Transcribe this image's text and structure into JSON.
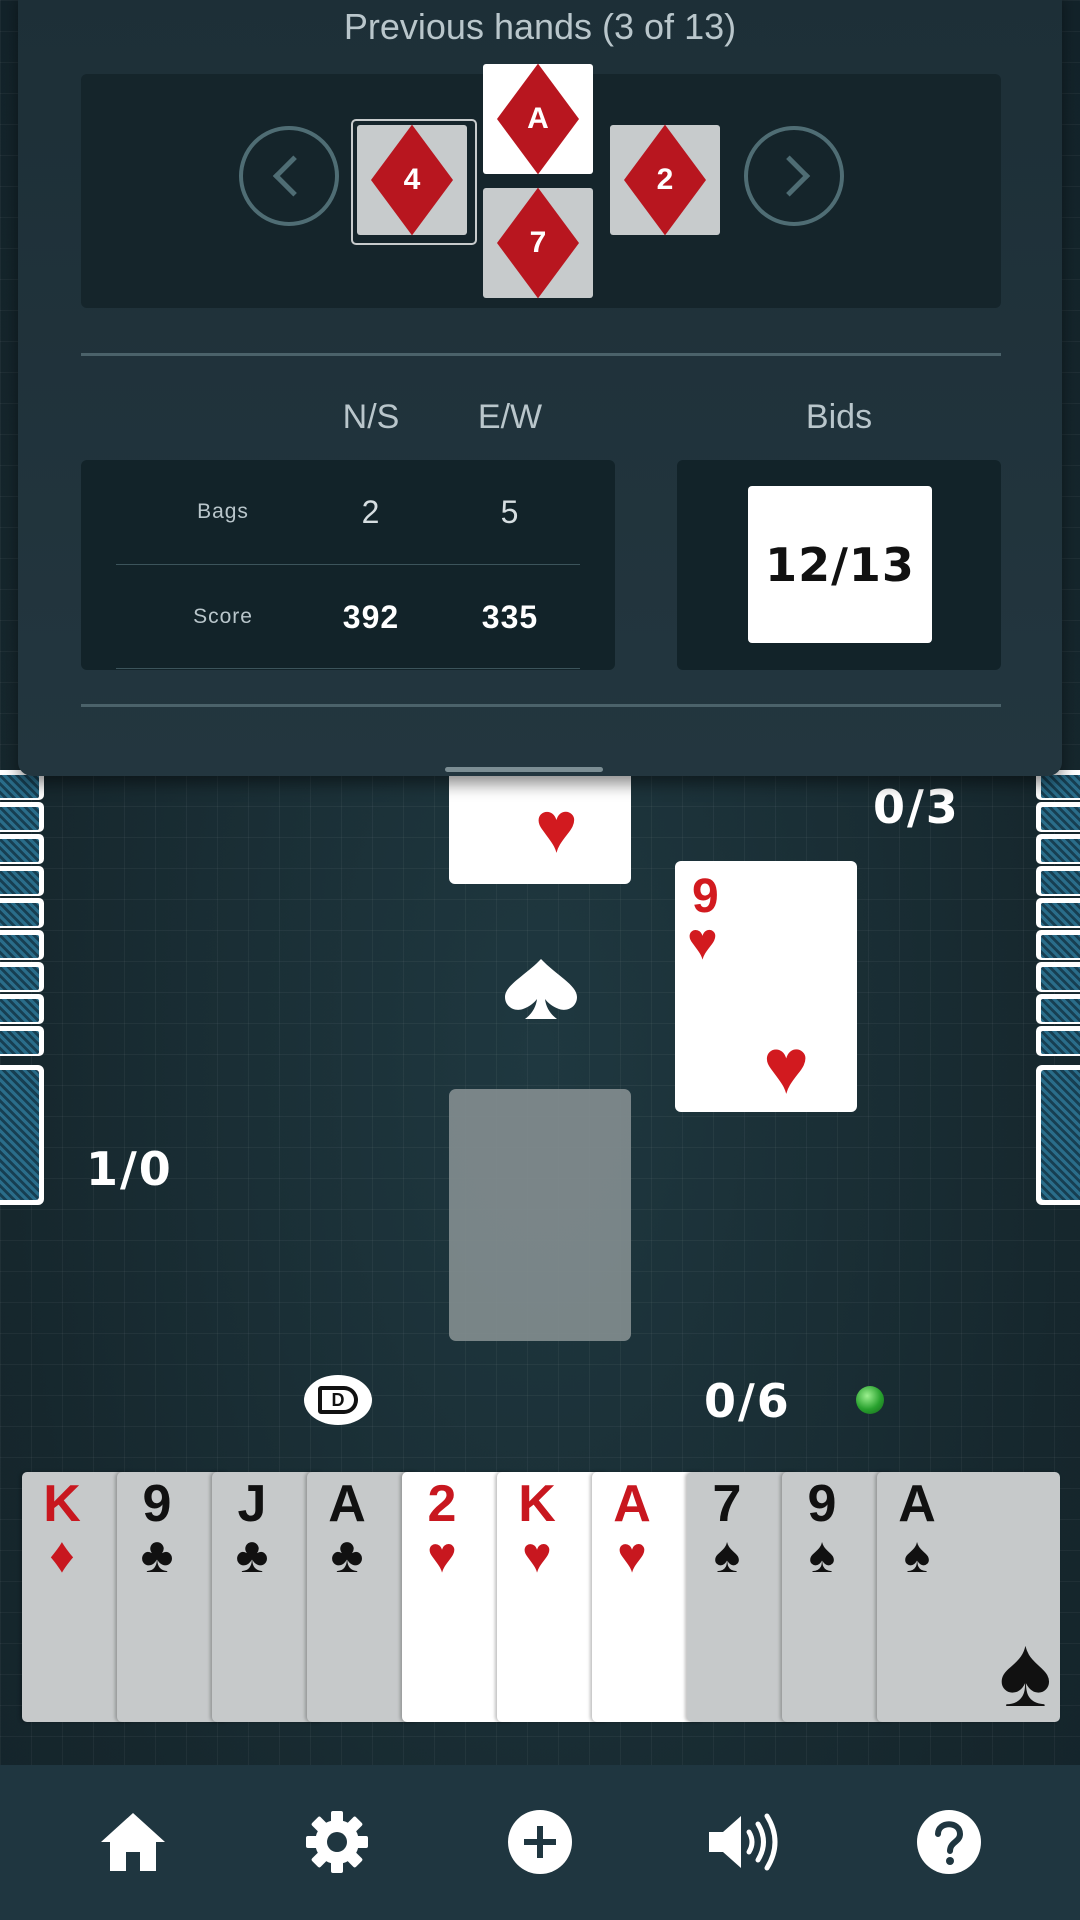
{
  "panel": {
    "title": "Previous hands (3 of 13)",
    "trick": {
      "north": {
        "rank": "A",
        "suit": "diamond"
      },
      "west": {
        "rank": "4",
        "suit": "diamond"
      },
      "east": {
        "rank": "2",
        "suit": "diamond"
      },
      "south": {
        "rank": "7",
        "suit": "diamond"
      }
    },
    "columns": {
      "ns": "N/S",
      "ew": "E/W",
      "bids": "Bids"
    },
    "rows": {
      "bags": {
        "label": "Bags",
        "ns": "2",
        "ew": "5"
      },
      "score": {
        "label": "Score",
        "ns": "392",
        "ew": "335"
      }
    },
    "bids_value": "12/13"
  },
  "table": {
    "north_count": "0/3",
    "west_count": "1/0",
    "south_count": "0/6",
    "trump_suit": "spade-icon",
    "dealer_label": "D",
    "played_east": {
      "rank": "9",
      "suit": "♥"
    },
    "played_north_suit": "♥"
  },
  "hand": [
    {
      "rank": "K",
      "suit": "♦",
      "color": "red",
      "active": false
    },
    {
      "rank": "9",
      "suit": "♣",
      "color": "black",
      "active": false
    },
    {
      "rank": "J",
      "suit": "♣",
      "color": "black",
      "active": false
    },
    {
      "rank": "A",
      "suit": "♣",
      "color": "black",
      "active": false
    },
    {
      "rank": "2",
      "suit": "♥",
      "color": "red",
      "active": true
    },
    {
      "rank": "K",
      "suit": "♥",
      "color": "red",
      "active": true
    },
    {
      "rank": "A",
      "suit": "♥",
      "color": "red",
      "active": true
    },
    {
      "rank": "7",
      "suit": "♠",
      "color": "black",
      "active": false
    },
    {
      "rank": "9",
      "suit": "♠",
      "color": "black",
      "active": false
    },
    {
      "rank": "A",
      "suit": "♠",
      "color": "black",
      "active": false
    }
  ],
  "bottom_nav": [
    "home-icon",
    "settings-icon",
    "add-icon",
    "sound-icon",
    "help-icon"
  ],
  "colors": {
    "red_suit": "#c8171f",
    "accent_green": "#28a12e",
    "bar": "#1f3640"
  }
}
